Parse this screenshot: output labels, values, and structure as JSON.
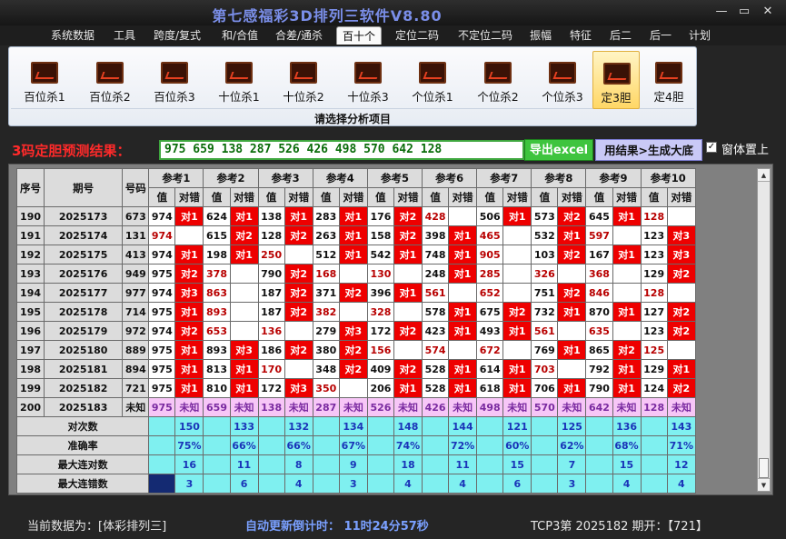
{
  "app": {
    "title": "第七感福彩3D排列三软件V8.80",
    "window_buttons": [
      "—",
      "▭",
      "✕"
    ]
  },
  "menu": [
    {
      "label": "系统数据",
      "active": false
    },
    {
      "label": "工具",
      "active": false
    },
    {
      "label": "跨度/复式",
      "active": false
    },
    {
      "label": "和/合值",
      "active": false
    },
    {
      "label": "合差/通杀",
      "active": false
    },
    {
      "label": "百十个",
      "active": true
    },
    {
      "label": "定位二码",
      "active": false
    },
    {
      "label": "不定位二码",
      "active": false
    },
    {
      "label": "振幅",
      "active": false
    },
    {
      "label": "特征",
      "active": false
    },
    {
      "label": "后二",
      "active": false
    },
    {
      "label": "后一",
      "active": false
    },
    {
      "label": "计划",
      "active": false
    }
  ],
  "ribbon": {
    "buttons": [
      {
        "label": "百位杀1",
        "icon": "chart-icon",
        "selected": false
      },
      {
        "label": "百位杀2",
        "icon": "chart-icon",
        "selected": false
      },
      {
        "label": "百位杀3",
        "icon": "chart-icon",
        "selected": false
      },
      {
        "label": "十位杀1",
        "icon": "chart-icon",
        "selected": false
      },
      {
        "label": "十位杀2",
        "icon": "chart-icon",
        "selected": false
      },
      {
        "label": "十位杀3",
        "icon": "chart-icon",
        "selected": false
      },
      {
        "label": "个位杀1",
        "icon": "chart-icon",
        "selected": false
      },
      {
        "label": "个位杀2",
        "icon": "chart-icon",
        "selected": false
      },
      {
        "label": "个位杀3",
        "icon": "chart-icon",
        "selected": false
      },
      {
        "label": "定3胆",
        "icon": "chart-icon",
        "selected": true
      },
      {
        "label": "定4胆",
        "icon": "chart-icon",
        "selected": false
      }
    ],
    "caption": "请选择分析项目"
  },
  "result": {
    "label": "3码定胆预测结果：",
    "value": "975 659 138 287 526 426 498 570 642 128",
    "excel_button": "导出excel",
    "export_button": "用结果>生成大底",
    "checkbox_label": "窗体置上",
    "checkbox_checked": true
  },
  "table": {
    "col_seq": "序号",
    "col_issue": "期号",
    "col_code": "号码",
    "ref_names": [
      "参考1",
      "参考2",
      "参考3",
      "参考4",
      "参考5",
      "参考6",
      "参考7",
      "参考8",
      "参考9",
      "参考10"
    ],
    "sub_value": "值",
    "sub_mark": "对错",
    "rows": [
      {
        "seq": "190",
        "issue": "2025173",
        "code": "673",
        "cells": [
          [
            "974",
            true,
            "对1"
          ],
          [
            "624",
            true,
            "对1"
          ],
          [
            "138",
            true,
            "对1"
          ],
          [
            "283",
            true,
            "对1"
          ],
          [
            "176",
            true,
            "对2"
          ],
          [
            "428",
            false,
            ""
          ],
          [
            "506",
            true,
            "对1"
          ],
          [
            "573",
            true,
            "对2"
          ],
          [
            "645",
            true,
            "对1"
          ],
          [
            "128",
            false,
            ""
          ]
        ]
      },
      {
        "seq": "191",
        "issue": "2025174",
        "code": "131",
        "cells": [
          [
            "974",
            false,
            ""
          ],
          [
            "615",
            true,
            "对2"
          ],
          [
            "128",
            true,
            "对2"
          ],
          [
            "263",
            true,
            "对1"
          ],
          [
            "158",
            true,
            "对2"
          ],
          [
            "398",
            true,
            "对1"
          ],
          [
            "465",
            false,
            ""
          ],
          [
            "532",
            true,
            "对1"
          ],
          [
            "597",
            false,
            ""
          ],
          [
            "123",
            true,
            "对3"
          ]
        ]
      },
      {
        "seq": "192",
        "issue": "2025175",
        "code": "413",
        "cells": [
          [
            "974",
            true,
            "对1"
          ],
          [
            "198",
            true,
            "对1"
          ],
          [
            "250",
            false,
            ""
          ],
          [
            "512",
            true,
            "对1"
          ],
          [
            "542",
            true,
            "对1"
          ],
          [
            "748",
            true,
            "对1"
          ],
          [
            "905",
            false,
            ""
          ],
          [
            "103",
            true,
            "对2"
          ],
          [
            "167",
            true,
            "对1"
          ],
          [
            "123",
            true,
            "对3"
          ]
        ]
      },
      {
        "seq": "193",
        "issue": "2025176",
        "code": "949",
        "cells": [
          [
            "975",
            true,
            "对2"
          ],
          [
            "378",
            false,
            ""
          ],
          [
            "790",
            true,
            "对2"
          ],
          [
            "168",
            false,
            ""
          ],
          [
            "130",
            false,
            ""
          ],
          [
            "248",
            true,
            "对1"
          ],
          [
            "285",
            false,
            ""
          ],
          [
            "326",
            false,
            ""
          ],
          [
            "368",
            false,
            ""
          ],
          [
            "129",
            true,
            "对2"
          ]
        ]
      },
      {
        "seq": "194",
        "issue": "2025177",
        "code": "977",
        "cells": [
          [
            "974",
            true,
            "对3"
          ],
          [
            "863",
            false,
            ""
          ],
          [
            "187",
            true,
            "对2"
          ],
          [
            "371",
            true,
            "对2"
          ],
          [
            "396",
            true,
            "对1"
          ],
          [
            "561",
            false,
            ""
          ],
          [
            "652",
            false,
            ""
          ],
          [
            "751",
            true,
            "对2"
          ],
          [
            "846",
            false,
            ""
          ],
          [
            "128",
            false,
            ""
          ]
        ]
      },
      {
        "seq": "195",
        "issue": "2025178",
        "code": "714",
        "cells": [
          [
            "975",
            true,
            "对1"
          ],
          [
            "893",
            false,
            ""
          ],
          [
            "187",
            true,
            "对2"
          ],
          [
            "382",
            false,
            ""
          ],
          [
            "328",
            false,
            ""
          ],
          [
            "578",
            true,
            "对1"
          ],
          [
            "675",
            true,
            "对2"
          ],
          [
            "732",
            true,
            "对1"
          ],
          [
            "870",
            true,
            "对1"
          ],
          [
            "127",
            true,
            "对2"
          ]
        ]
      },
      {
        "seq": "196",
        "issue": "2025179",
        "code": "972",
        "cells": [
          [
            "974",
            true,
            "对2"
          ],
          [
            "653",
            false,
            ""
          ],
          [
            "136",
            false,
            ""
          ],
          [
            "279",
            true,
            "对3"
          ],
          [
            "172",
            true,
            "对2"
          ],
          [
            "423",
            true,
            "对1"
          ],
          [
            "493",
            true,
            "对1"
          ],
          [
            "561",
            false,
            ""
          ],
          [
            "635",
            false,
            ""
          ],
          [
            "123",
            true,
            "对2"
          ]
        ]
      },
      {
        "seq": "197",
        "issue": "2025180",
        "code": "889",
        "cells": [
          [
            "975",
            true,
            "对1"
          ],
          [
            "893",
            true,
            "对3"
          ],
          [
            "186",
            true,
            "对2"
          ],
          [
            "380",
            true,
            "对2"
          ],
          [
            "156",
            false,
            ""
          ],
          [
            "574",
            false,
            ""
          ],
          [
            "672",
            false,
            ""
          ],
          [
            "769",
            true,
            "对1"
          ],
          [
            "865",
            true,
            "对2"
          ],
          [
            "125",
            false,
            ""
          ]
        ]
      },
      {
        "seq": "198",
        "issue": "2025181",
        "code": "894",
        "cells": [
          [
            "975",
            true,
            "对1"
          ],
          [
            "813",
            true,
            "对1"
          ],
          [
            "170",
            false,
            ""
          ],
          [
            "348",
            true,
            "对2"
          ],
          [
            "409",
            true,
            "对2"
          ],
          [
            "528",
            true,
            "对1"
          ],
          [
            "614",
            true,
            "对1"
          ],
          [
            "703",
            false,
            ""
          ],
          [
            "792",
            true,
            "对1"
          ],
          [
            "129",
            true,
            "对1"
          ]
        ]
      },
      {
        "seq": "199",
        "issue": "2025182",
        "code": "721",
        "cells": [
          [
            "975",
            true,
            "对1"
          ],
          [
            "810",
            true,
            "对1"
          ],
          [
            "172",
            true,
            "对3"
          ],
          [
            "350",
            false,
            ""
          ],
          [
            "206",
            true,
            "对1"
          ],
          [
            "528",
            true,
            "对1"
          ],
          [
            "618",
            true,
            "对1"
          ],
          [
            "706",
            true,
            "对1"
          ],
          [
            "790",
            true,
            "对1"
          ],
          [
            "124",
            true,
            "对2"
          ]
        ]
      }
    ],
    "prediction_row": {
      "seq": "200",
      "issue": "2025183",
      "code": "未知",
      "values": [
        "975",
        "659",
        "138",
        "287",
        "526",
        "426",
        "498",
        "570",
        "642",
        "128"
      ],
      "mark": "未知"
    },
    "stats": [
      {
        "label": "对次数",
        "values": [
          "150",
          "133",
          "132",
          "134",
          "148",
          "144",
          "121",
          "125",
          "136",
          "143"
        ]
      },
      {
        "label": "准确率",
        "values": [
          "75%",
          "66%",
          "66%",
          "67%",
          "74%",
          "72%",
          "60%",
          "62%",
          "68%",
          "71%"
        ]
      },
      {
        "label": "最大连对数",
        "values": [
          "16",
          "11",
          "8",
          "9",
          "18",
          "11",
          "15",
          "7",
          "15",
          "12"
        ]
      },
      {
        "label": "最大连错数",
        "values": [
          "3",
          "6",
          "4",
          "3",
          "4",
          "4",
          "6",
          "3",
          "4",
          "4"
        ]
      }
    ]
  },
  "status": {
    "current_data": "当前数据为：[体彩排列三]",
    "countdown": "自动更新倒计时：  11时24分57秒",
    "draw_info": "TCP3第 2025182 期开：【721】"
  }
}
